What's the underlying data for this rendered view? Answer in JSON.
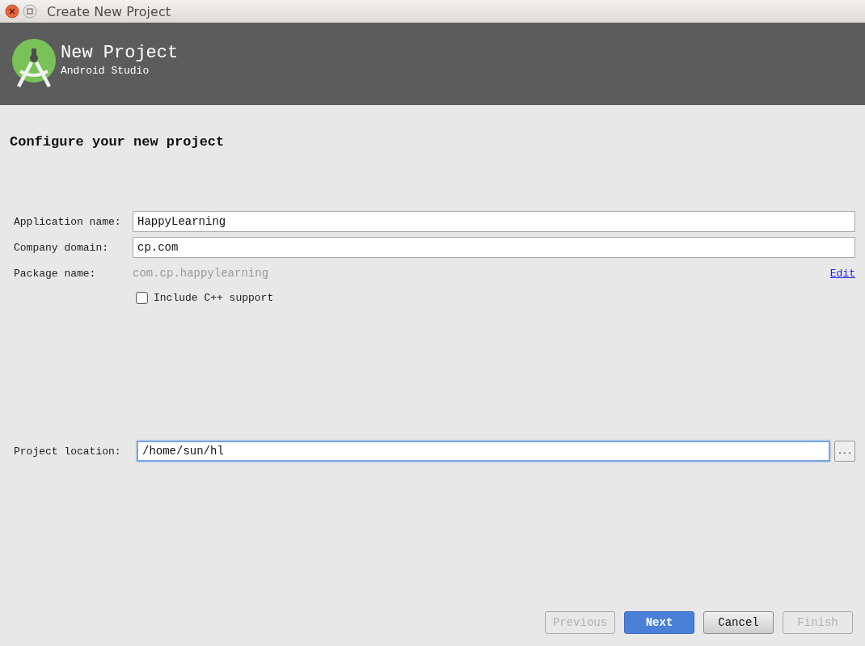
{
  "window": {
    "title": "Create New Project"
  },
  "header": {
    "title": "New Project",
    "subtitle": "Android Studio"
  },
  "heading": "Configure your new project",
  "fields": [
    {
      "label": "Application name:",
      "value": "HappyLearning",
      "focused": false
    },
    {
      "label": "Company domain:",
      "value": "cp.com",
      "focused": false
    }
  ],
  "package": {
    "label": "Package name:",
    "value": "com.cp.happylearning",
    "link": "Edit"
  },
  "cpp_checkbox": {
    "label": "Include C++ support",
    "checked": false
  },
  "location": {
    "label": "Project location:",
    "value": "/home/sun/hl",
    "focused": true,
    "browse": "..."
  },
  "buttons": [
    {
      "label": "Previous",
      "kind": "normal",
      "disabled": true
    },
    {
      "label": "Next",
      "kind": "primary",
      "disabled": false
    },
    {
      "label": "Cancel",
      "kind": "normal",
      "disabled": false
    },
    {
      "label": "Finish",
      "kind": "normal",
      "disabled": true
    }
  ]
}
